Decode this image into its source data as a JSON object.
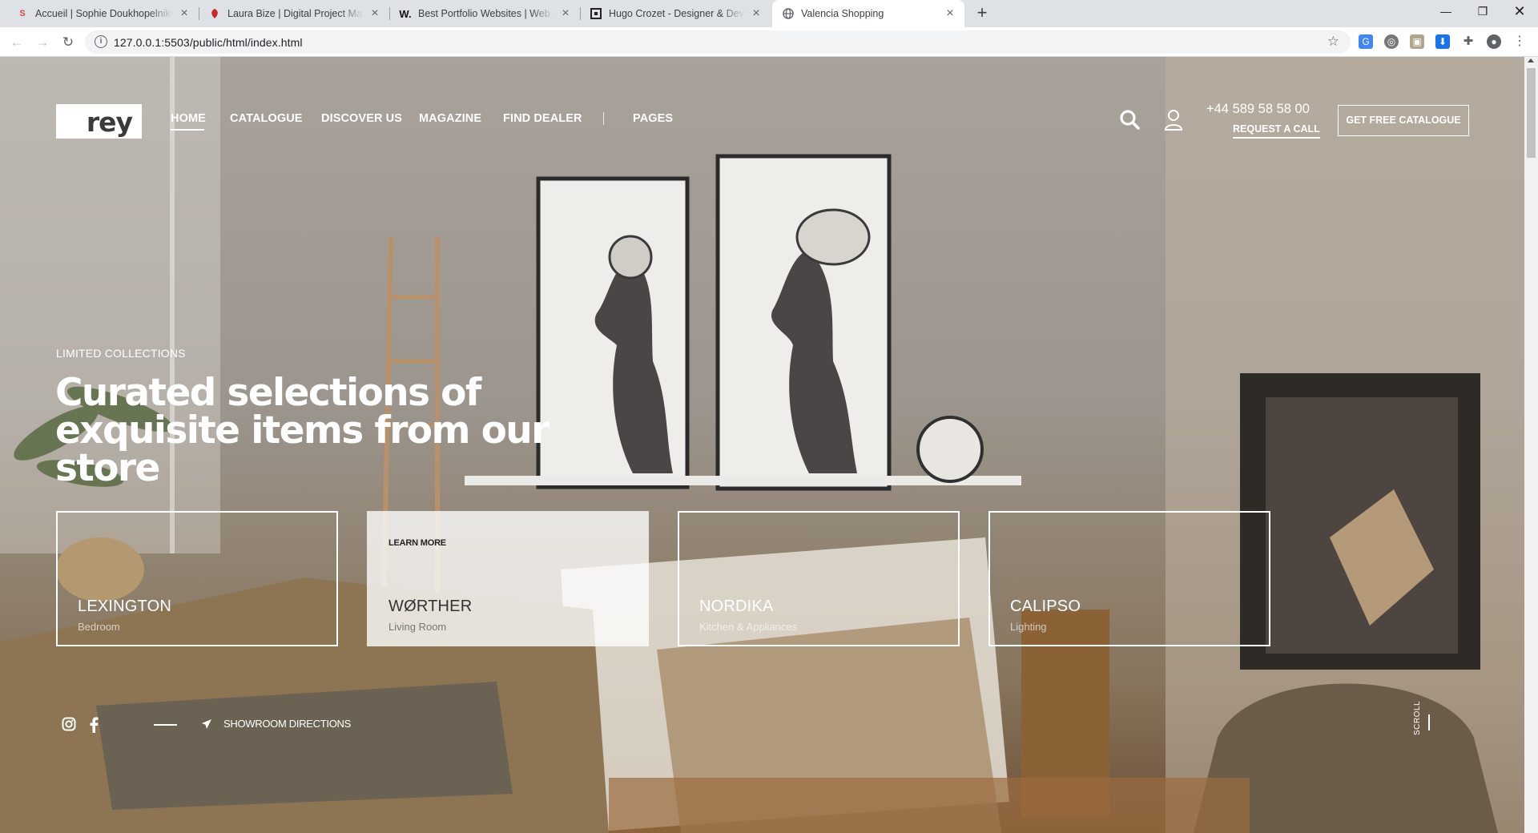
{
  "browser": {
    "tabs": [
      {
        "title": "Accueil | Sophie Doukhopelnikoff",
        "favicon": "sd-logo-icon"
      },
      {
        "title": "Laura Bize | Digital Project Manager",
        "favicon": "red-leaf-icon"
      },
      {
        "title": "Best Portfolio Websites | Web Design Inspiration",
        "favicon": "w-logo-icon"
      },
      {
        "title": "Hugo Crozet - Designer & Developer",
        "favicon": "hc-logo-icon"
      },
      {
        "title": "Valencia Shopping",
        "favicon": "globe-icon",
        "active": true
      }
    ],
    "url": "127.0.0.1:5503/public/html/index.html"
  },
  "site": {
    "logo_text": "rey",
    "nav": [
      "HOME",
      "CATALOGUE",
      "DISCOVER US",
      "MAGAZINE",
      "FIND DEALER",
      "PAGES"
    ],
    "phone": "+44 589 58 58 00",
    "request_call": "REQUEST A CALL",
    "cta": "GET FREE CATALOGUE"
  },
  "hero": {
    "eyebrow": "LIMITED COLLECTIONS",
    "title": "Curated selections of exquisite items from our store",
    "cards": [
      {
        "name": "LEXINGTON",
        "category": "Bedroom",
        "learn_more": ""
      },
      {
        "name": "WØRTHER",
        "category": "Living Room",
        "learn_more": "LEARN MORE"
      },
      {
        "name": "NORDIKA",
        "category": "Kitchen & Appliances",
        "learn_more": ""
      },
      {
        "name": "CALIPSO",
        "category": "Lighting",
        "learn_more": ""
      }
    ],
    "showroom": "SHOWROOM DIRECTIONS",
    "scroll": "SCROLL"
  },
  "colors": {
    "accent": "#ffffff",
    "overlay": "#28221c",
    "tab_active": "#ffffff"
  }
}
